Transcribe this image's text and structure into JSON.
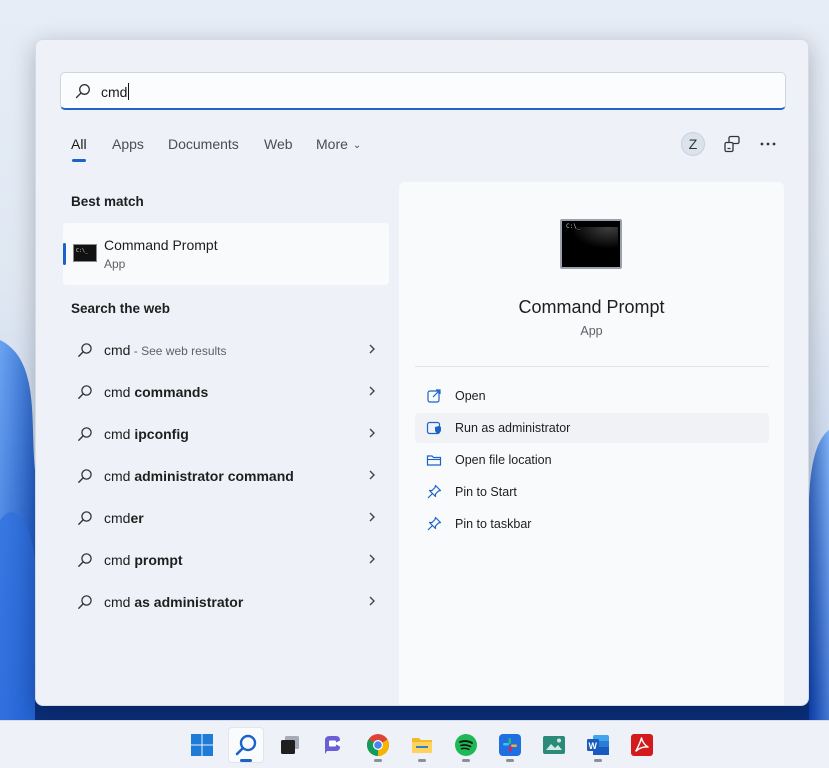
{
  "search": {
    "query": "cmd"
  },
  "tabs": [
    {
      "label": "All",
      "active": true
    },
    {
      "label": "Apps",
      "active": false
    },
    {
      "label": "Documents",
      "active": false
    },
    {
      "label": "Web",
      "active": false
    },
    {
      "label": "More",
      "active": false
    }
  ],
  "account": {
    "initial": "Z"
  },
  "toolbar_icons": [
    "share-devices-icon",
    "more-options-icon"
  ],
  "best_match": {
    "heading": "Best match",
    "name": "Command Prompt",
    "type": "App",
    "icon": "command-prompt-icon"
  },
  "web": {
    "heading": "Search the web",
    "results": [
      {
        "prefix": "cmd",
        "bold": "",
        "suffix": " - See web results"
      },
      {
        "prefix": "cmd ",
        "bold": "commands",
        "suffix": ""
      },
      {
        "prefix": "cmd ",
        "bold": "ipconfig",
        "suffix": ""
      },
      {
        "prefix": "cmd ",
        "bold": "administrator command",
        "suffix": ""
      },
      {
        "prefix": "cmd",
        "bold": "er",
        "suffix": ""
      },
      {
        "prefix": "cmd ",
        "bold": "prompt",
        "suffix": ""
      },
      {
        "prefix": "cmd ",
        "bold": "as administrator",
        "suffix": ""
      }
    ]
  },
  "detail": {
    "title": "Command Prompt",
    "subtitle": "App",
    "actions": [
      {
        "label": "Open",
        "icon": "open-external-icon"
      },
      {
        "label": "Run as administrator",
        "icon": "shield-window-icon"
      },
      {
        "label": "Open file location",
        "icon": "folder-icon"
      },
      {
        "label": "Pin to Start",
        "icon": "pin-icon"
      },
      {
        "label": "Pin to taskbar",
        "icon": "pin-icon"
      }
    ]
  },
  "taskbar": [
    {
      "name": "start-icon"
    },
    {
      "name": "search-icon"
    },
    {
      "name": "task-view-icon"
    },
    {
      "name": "teams-chat-icon"
    },
    {
      "name": "chrome-icon"
    },
    {
      "name": "file-explorer-icon"
    },
    {
      "name": "spotify-icon"
    },
    {
      "name": "slack-icon"
    },
    {
      "name": "image-app-icon"
    },
    {
      "name": "word-icon"
    },
    {
      "name": "acrobat-icon"
    }
  ],
  "colors": {
    "accent": "#1b63c6"
  }
}
